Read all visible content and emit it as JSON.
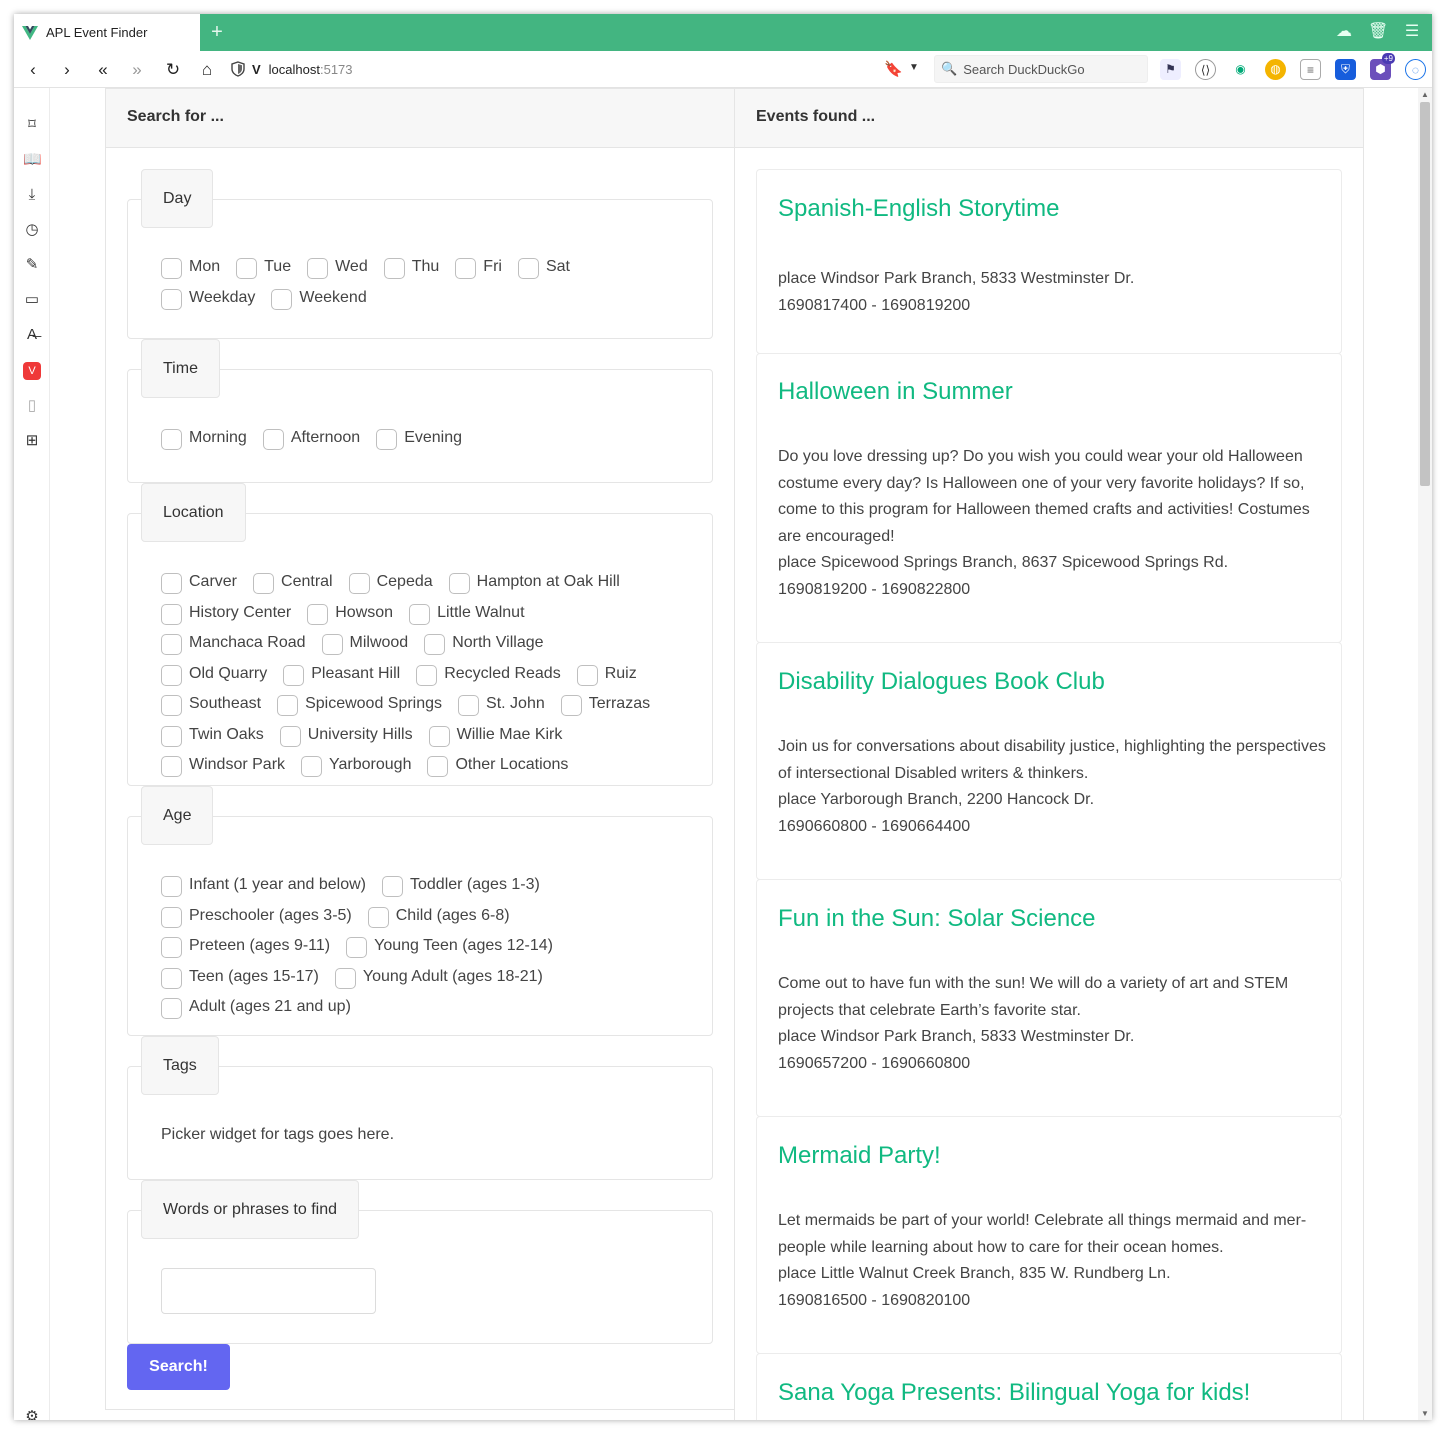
{
  "browser": {
    "tab_title": "APL Event Finder",
    "new_tab": "+",
    "url_host": "localhost",
    "url_port": ":5173",
    "search_placeholder": "Search DuckDuckGo",
    "ext_badge": "+9"
  },
  "left": {
    "header": "Search for ...",
    "day": {
      "legend": "Day",
      "options": [
        "Mon",
        "Tue",
        "Wed",
        "Thu",
        "Fri",
        "Sat",
        "Weekday",
        "Weekend"
      ]
    },
    "time": {
      "legend": "Time",
      "options": [
        "Morning",
        "Afternoon",
        "Evening"
      ]
    },
    "location": {
      "legend": "Location",
      "rows": [
        [
          "Carver",
          "Central",
          "Cepeda",
          "Hampton at Oak Hill"
        ],
        [
          "History Center",
          "Howson",
          "Little Walnut"
        ],
        [
          "Manchaca Road",
          "Milwood",
          "North Village"
        ],
        [
          "Old Quarry",
          "Pleasant Hill",
          "Recycled Reads",
          "Ruiz"
        ],
        [
          "Southeast",
          "Spicewood Springs",
          "St. John",
          "Terrazas"
        ],
        [
          "Twin Oaks",
          "University Hills",
          "Willie Mae Kirk"
        ],
        [
          "Windsor Park",
          "Yarborough",
          "Other Locations"
        ]
      ]
    },
    "age": {
      "legend": "Age",
      "rows": [
        [
          "Infant (1 year and below)",
          "Toddler (ages 1-3)"
        ],
        [
          "Preschooler (ages 3-5)",
          "Child (ages 6-8)"
        ],
        [
          "Preteen (ages 9-11)",
          "Young Teen (ages 12-14)"
        ],
        [
          "Teen (ages 15-17)",
          "Young Adult (ages 18-21)"
        ],
        [
          "Adult (ages 21 and up)"
        ]
      ]
    },
    "tags": {
      "legend": "Tags",
      "note": "Picker widget for tags goes here."
    },
    "words": {
      "legend": "Words or phrases to find",
      "value": ""
    },
    "search_button": "Search!"
  },
  "right": {
    "header": "Events found ...",
    "events": [
      {
        "title": "Spanish-English Storytime",
        "description": "",
        "place": "place Windsor Park Branch, 5833 Westminster Dr.",
        "time": "1690817400 - 1690819200"
      },
      {
        "title": "Halloween in Summer",
        "description": "Do you love dressing up? Do you wish you could wear your old Halloween costume every day? Is Halloween one of your very favorite holidays? If so, come to this program for Halloween themed crafts and activities! Costumes are encouraged!",
        "place": "place Spicewood Springs Branch, 8637 Spicewood Springs Rd.",
        "time": "1690819200 - 1690822800"
      },
      {
        "title": "Disability Dialogues Book Club",
        "description": "Join us for conversations about disability justice, highlighting the perspectives of intersectional Disabled writers & thinkers.",
        "place": "place Yarborough Branch, 2200 Hancock Dr.",
        "time": "1690660800 - 1690664400"
      },
      {
        "title": "Fun in the Sun: Solar Science",
        "description": "Come out to have fun with the sun! We will do a variety of art and STEM projects that celebrate Earth’s favorite star.",
        "place": "place Windsor Park Branch, 5833 Westminster Dr.",
        "time": "1690657200 - 1690660800"
      },
      {
        "title": "Mermaid Party!",
        "description": "Let mermaids be part of your world! Celebrate all things mermaid and mer-people while learning about how to care for their ocean homes.",
        "place": "place Little Walnut Creek Branch, 835 W. Rundberg Ln.",
        "time": "1690816500 - 1690820100"
      },
      {
        "title": "Sana Yoga Presents: Bilingual Yoga for kids!",
        "description": "",
        "place": "",
        "time": ""
      }
    ]
  },
  "colors": {
    "browser_accent": "#43b581",
    "event_title": "#10b981",
    "search_button": "#6366f1"
  }
}
